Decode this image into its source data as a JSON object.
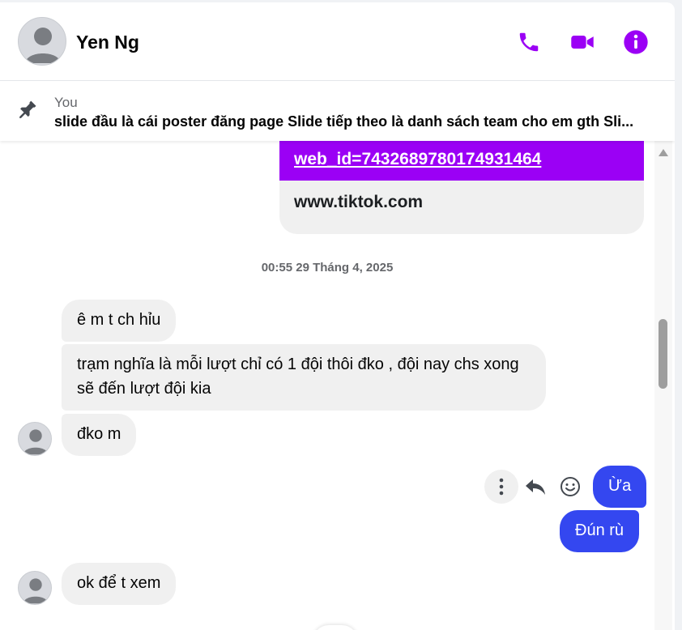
{
  "header": {
    "name": "Yen Ng",
    "icons": [
      "phone-icon",
      "video-icon",
      "info-icon"
    ],
    "accent": "#9b00f5"
  },
  "pinned": {
    "sender": "You",
    "text": "slide đầu là cái poster đăng page Slide tiếp theo là danh sách team cho em gth Sli..."
  },
  "link_card": {
    "url_fragment": "web_id=7432689780174931464",
    "domain": "www.tiktok.com"
  },
  "timestamp": "00:55 29 Tháng 4, 2025",
  "messages": {
    "m1": "ê m t ch hỉu",
    "m2": "trạm nghĩa là mỗi lượt chỉ có 1 đội thôi đko , đội nay chs xong sẽ đến lượt đội kia",
    "m3": "đko m",
    "m4": "Ừa",
    "m5": "Đún rù",
    "m6": "ok để t xem"
  },
  "colors": {
    "outgoing_bubble": "#3447f0",
    "incoming_bubble": "#f0f0f0"
  }
}
